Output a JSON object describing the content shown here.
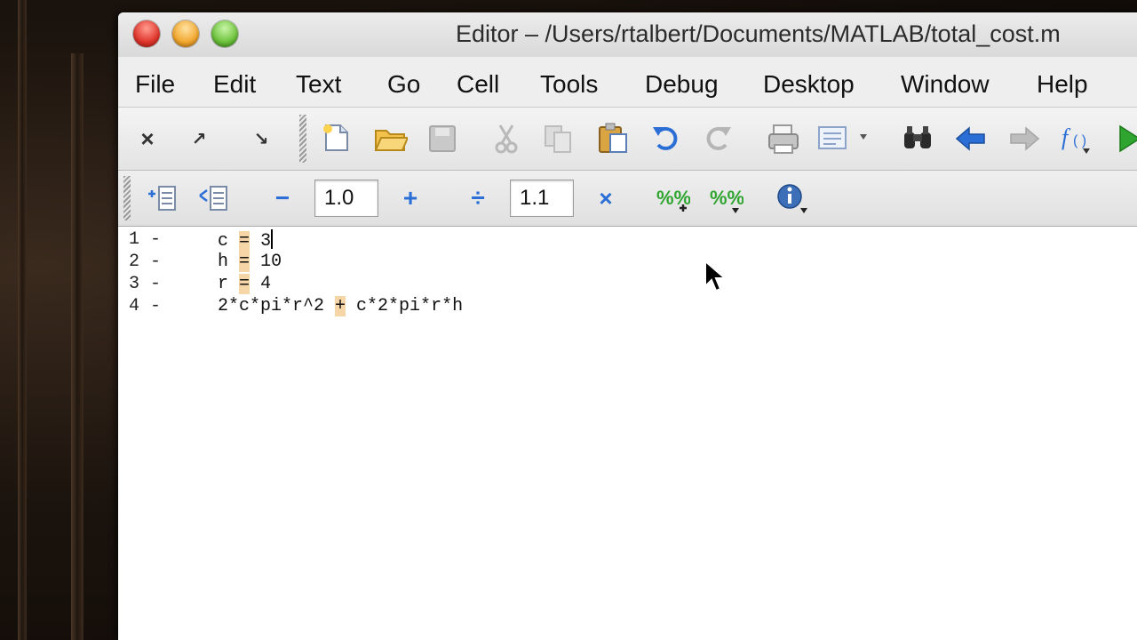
{
  "window": {
    "title": "Editor – /Users/rtalbert/Documents/MATLAB/total_cost.m"
  },
  "menu": [
    "File",
    "Edit",
    "Text",
    "Go",
    "Cell",
    "Tools",
    "Debug",
    "Desktop",
    "Window",
    "Help"
  ],
  "toolbar": {
    "close_label": "×",
    "undock_label": "↗",
    "dock_label": "↘"
  },
  "cell_toolbar": {
    "minus_label": "−",
    "value1": "1.0",
    "plus_label": "+",
    "divide_label": "÷",
    "value2": "1.1",
    "times_label": "×"
  },
  "editor": {
    "lines": [
      {
        "num": "1",
        "marker": "-"
      },
      {
        "num": "2",
        "marker": "-"
      },
      {
        "num": "3",
        "marker": "-"
      },
      {
        "num": "4",
        "marker": "-"
      }
    ],
    "code": [
      {
        "lhs": "c",
        "op": "=",
        "rhs": "3"
      },
      {
        "lhs": "h",
        "op": "=",
        "rhs": "10"
      },
      {
        "lhs": "r",
        "op": "=",
        "rhs": "4"
      },
      {
        "pre": "2*c*pi*r^2 ",
        "op": "+",
        "post": " c*2*pi*r*h"
      }
    ]
  },
  "colors": {
    "accent_blue": "#2b6fd6",
    "warning_orange": "#e38a16",
    "run_green": "#2fa52f"
  }
}
